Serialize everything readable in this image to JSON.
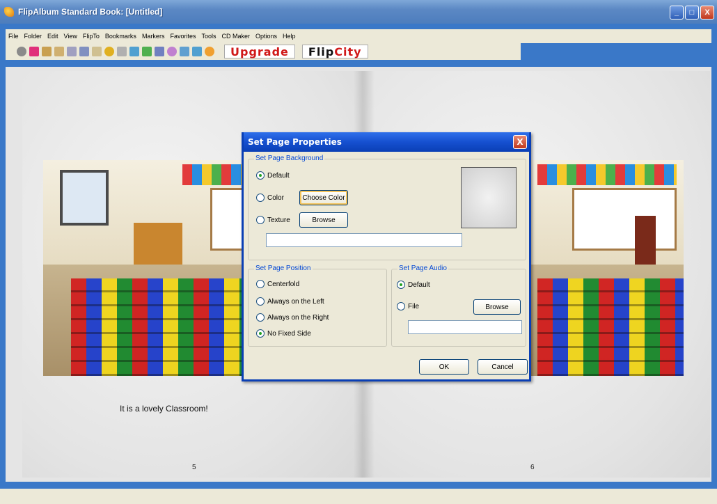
{
  "window": {
    "title": "FlipAlbum Standard   Book: [Untitled]",
    "minimize": "_",
    "maximize": "□",
    "close": "X"
  },
  "menu": {
    "items": [
      "File",
      "Folder",
      "Edit",
      "View",
      "FlipTo",
      "Bookmarks",
      "Markers",
      "Favorites",
      "Tools",
      "CD Maker",
      "Options",
      "Help"
    ]
  },
  "toolbar": {
    "upgrade_label": "Upgrade",
    "flipcity_prefix": "Flip",
    "flipcity_accent": "City",
    "icon_colors": [
      "#8a8a8a",
      "#e0307a",
      "#c9a050",
      "#d0b070",
      "#a0a0c0",
      "#8090c0",
      "#d0c090",
      "#8a8a8a",
      "#e0b020",
      "#b0b0b0",
      "#50a0d0",
      "#50b050",
      "#7080c0",
      "#c080d0",
      "#60a0d0",
      "#50a0d0",
      "#f0a030"
    ]
  },
  "book": {
    "left_caption": "It is a lovely Classroom!",
    "left_page_number": "5",
    "right_page_number": "6"
  },
  "dialog": {
    "title": "Set Page Properties",
    "close_label": "X",
    "background_group": {
      "title": "Set Page Background",
      "default_label": "Default",
      "color_label": "Color",
      "choose_color_label": "Choose Color",
      "texture_label": "Texture",
      "browse_label": "Browse",
      "texture_path": "",
      "selected": "Default"
    },
    "position_group": {
      "title": "Set Page Position",
      "options": [
        "Centerfold",
        "Always on the Left",
        "Always on the Right",
        "No Fixed Side"
      ],
      "selected": "No Fixed Side"
    },
    "audio_group": {
      "title": "Set Page Audio",
      "default_label": "Default",
      "file_label": "File",
      "browse_label": "Browse",
      "file_path": "",
      "selected": "Default"
    },
    "ok_label": "OK",
    "cancel_label": "Cancel"
  },
  "colors": {
    "accent_blue": "#0a3fb5",
    "arrow_red": "#a01c1c",
    "upgrade_red": "#d01818"
  }
}
